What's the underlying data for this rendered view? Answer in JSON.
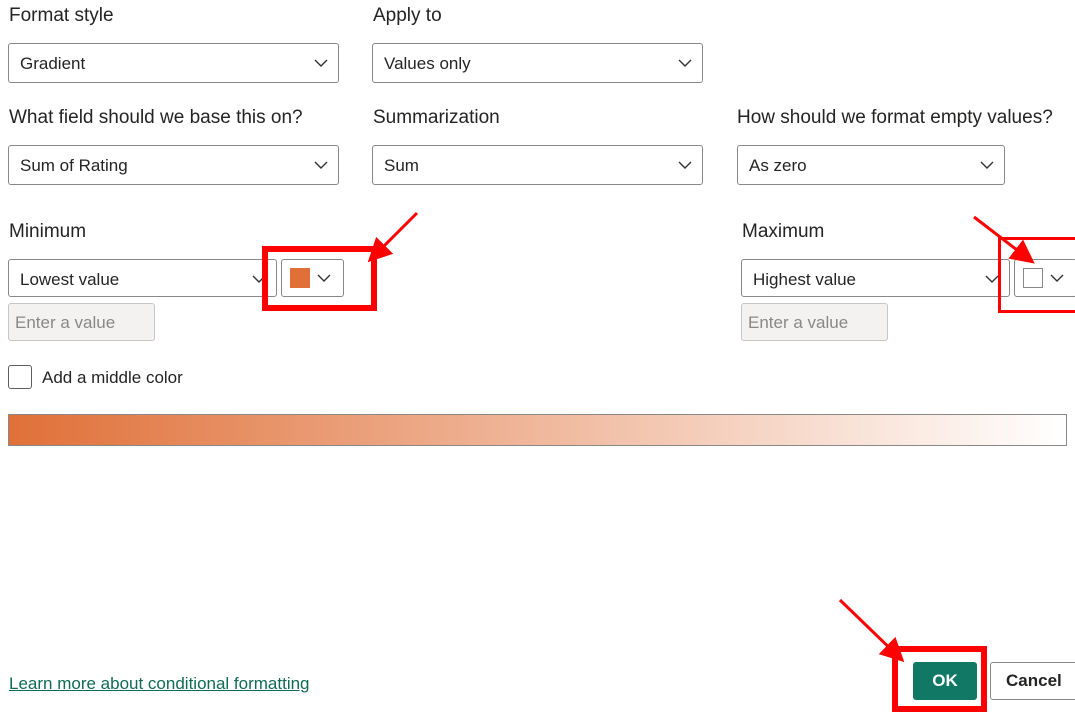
{
  "format_style": {
    "label": "Format style",
    "value": "Gradient"
  },
  "apply_to": {
    "label": "Apply to",
    "value": "Values only"
  },
  "base_field": {
    "label": "What field should we base this on?",
    "value": "Sum of Rating"
  },
  "summarization": {
    "label": "Summarization",
    "value": "Sum"
  },
  "empty_values": {
    "label": "How should we format empty values?",
    "value": "As zero"
  },
  "minimum": {
    "label": "Minimum",
    "value": "Lowest value",
    "placeholder": "Enter a value",
    "color": "#e07038"
  },
  "maximum": {
    "label": "Maximum",
    "value": "Highest value",
    "placeholder": "Enter a value",
    "color": "#ffffff"
  },
  "middle_color": {
    "label": "Add a middle color",
    "checked": false
  },
  "gradient": {
    "from": "#e07038",
    "to": "#ffffff"
  },
  "footer": {
    "learn_more": "Learn more about conditional formatting",
    "ok": "OK",
    "cancel": "Cancel"
  },
  "annotation_color": "#ff0000",
  "icons": [
    "chevron-down-icon",
    "color-swatch-icon",
    "annotation-arrow-icon"
  ]
}
